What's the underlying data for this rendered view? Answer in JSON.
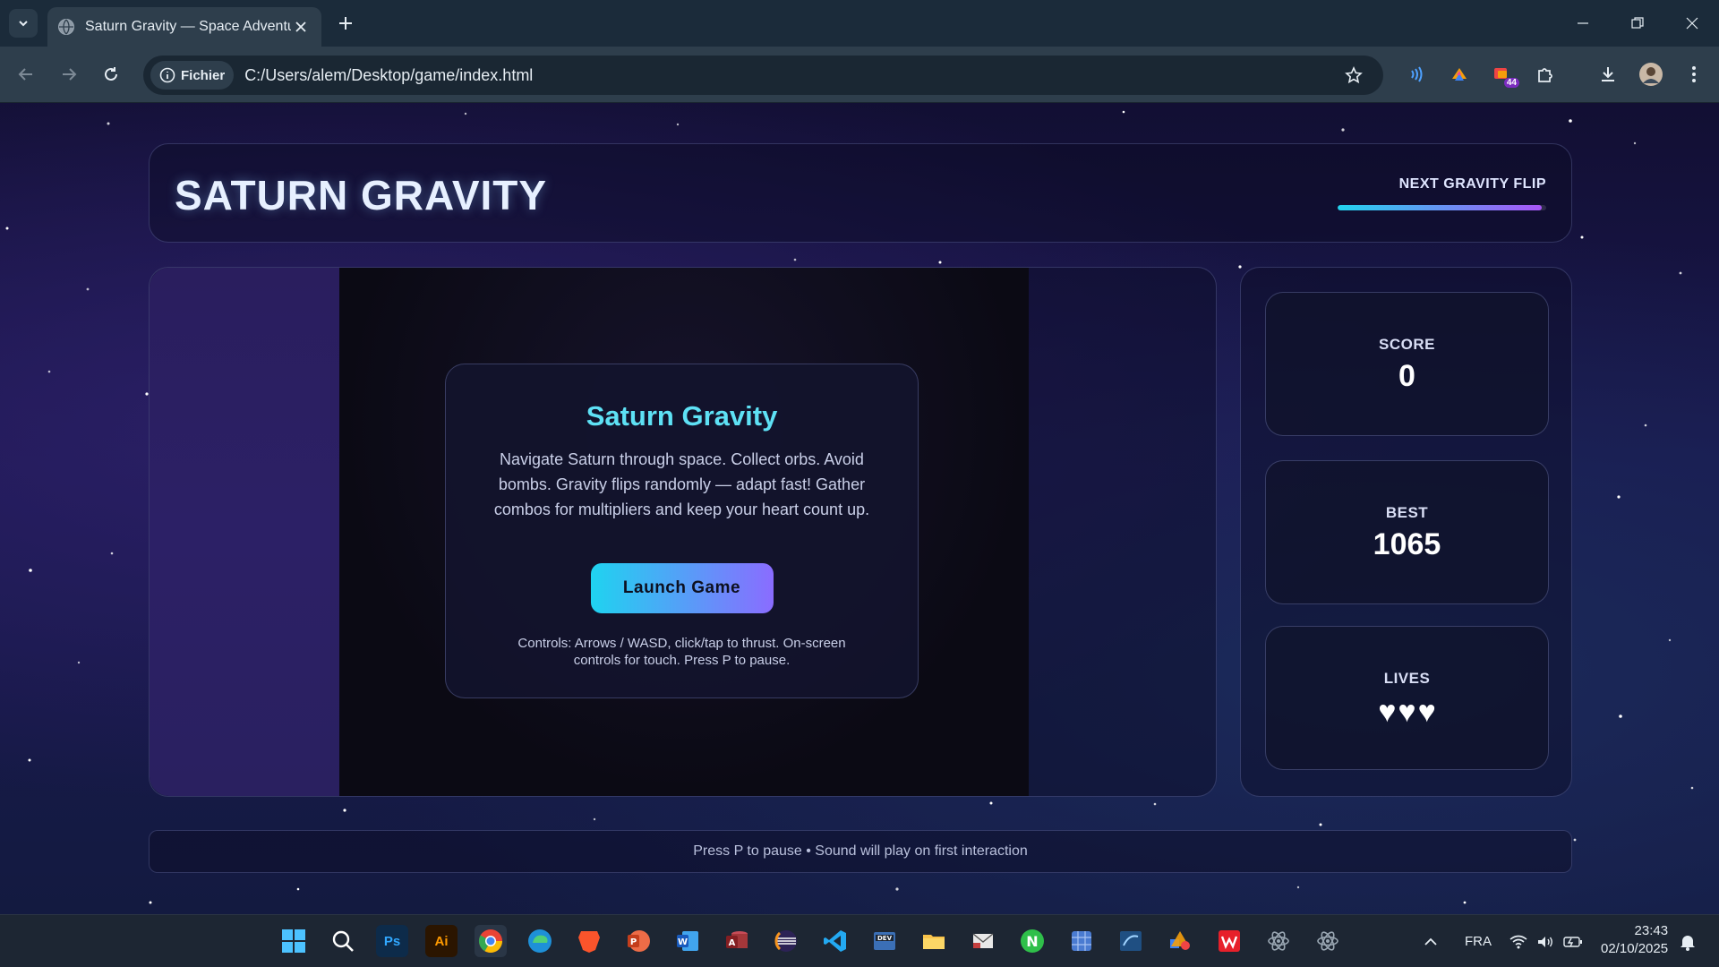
{
  "browser": {
    "tab_title": "Saturn Gravity — Space Adventure",
    "site_chip": "Fichier",
    "url": "C:/Users/alem/Desktop/game/index.html",
    "extension_badge": "44"
  },
  "header": {
    "title": "SATURN GRAVITY",
    "flip_label": "NEXT GRAVITY FLIP",
    "flip_progress": 0.98
  },
  "start_overlay": {
    "title": "Saturn Gravity",
    "description": "Navigate Saturn through space. Collect orbs. Avoid bombs. Gravity flips randomly — adapt fast! Gather combos for multipliers and keep your heart count up.",
    "button_label": "Launch Game",
    "controls_note": "Controls: Arrows / WASD, click/tap to thrust. On-screen controls for touch. Press P to pause."
  },
  "stats": {
    "score_label": "SCORE",
    "score_value": "0",
    "best_label": "BEST",
    "best_value": "1065",
    "lives_label": "LIVES",
    "lives_count": 3
  },
  "footer": {
    "text": "Press P to pause • Sound will play on first interaction"
  },
  "taskbar": {
    "language": "FRA",
    "time": "23:43",
    "date": "02/10/2025",
    "apps": [
      "Ps",
      "Ai"
    ]
  },
  "colors": {
    "accent_cyan": "#22d3ee",
    "accent_purple": "#a855f7",
    "title_cyan": "#5ee1f5"
  }
}
